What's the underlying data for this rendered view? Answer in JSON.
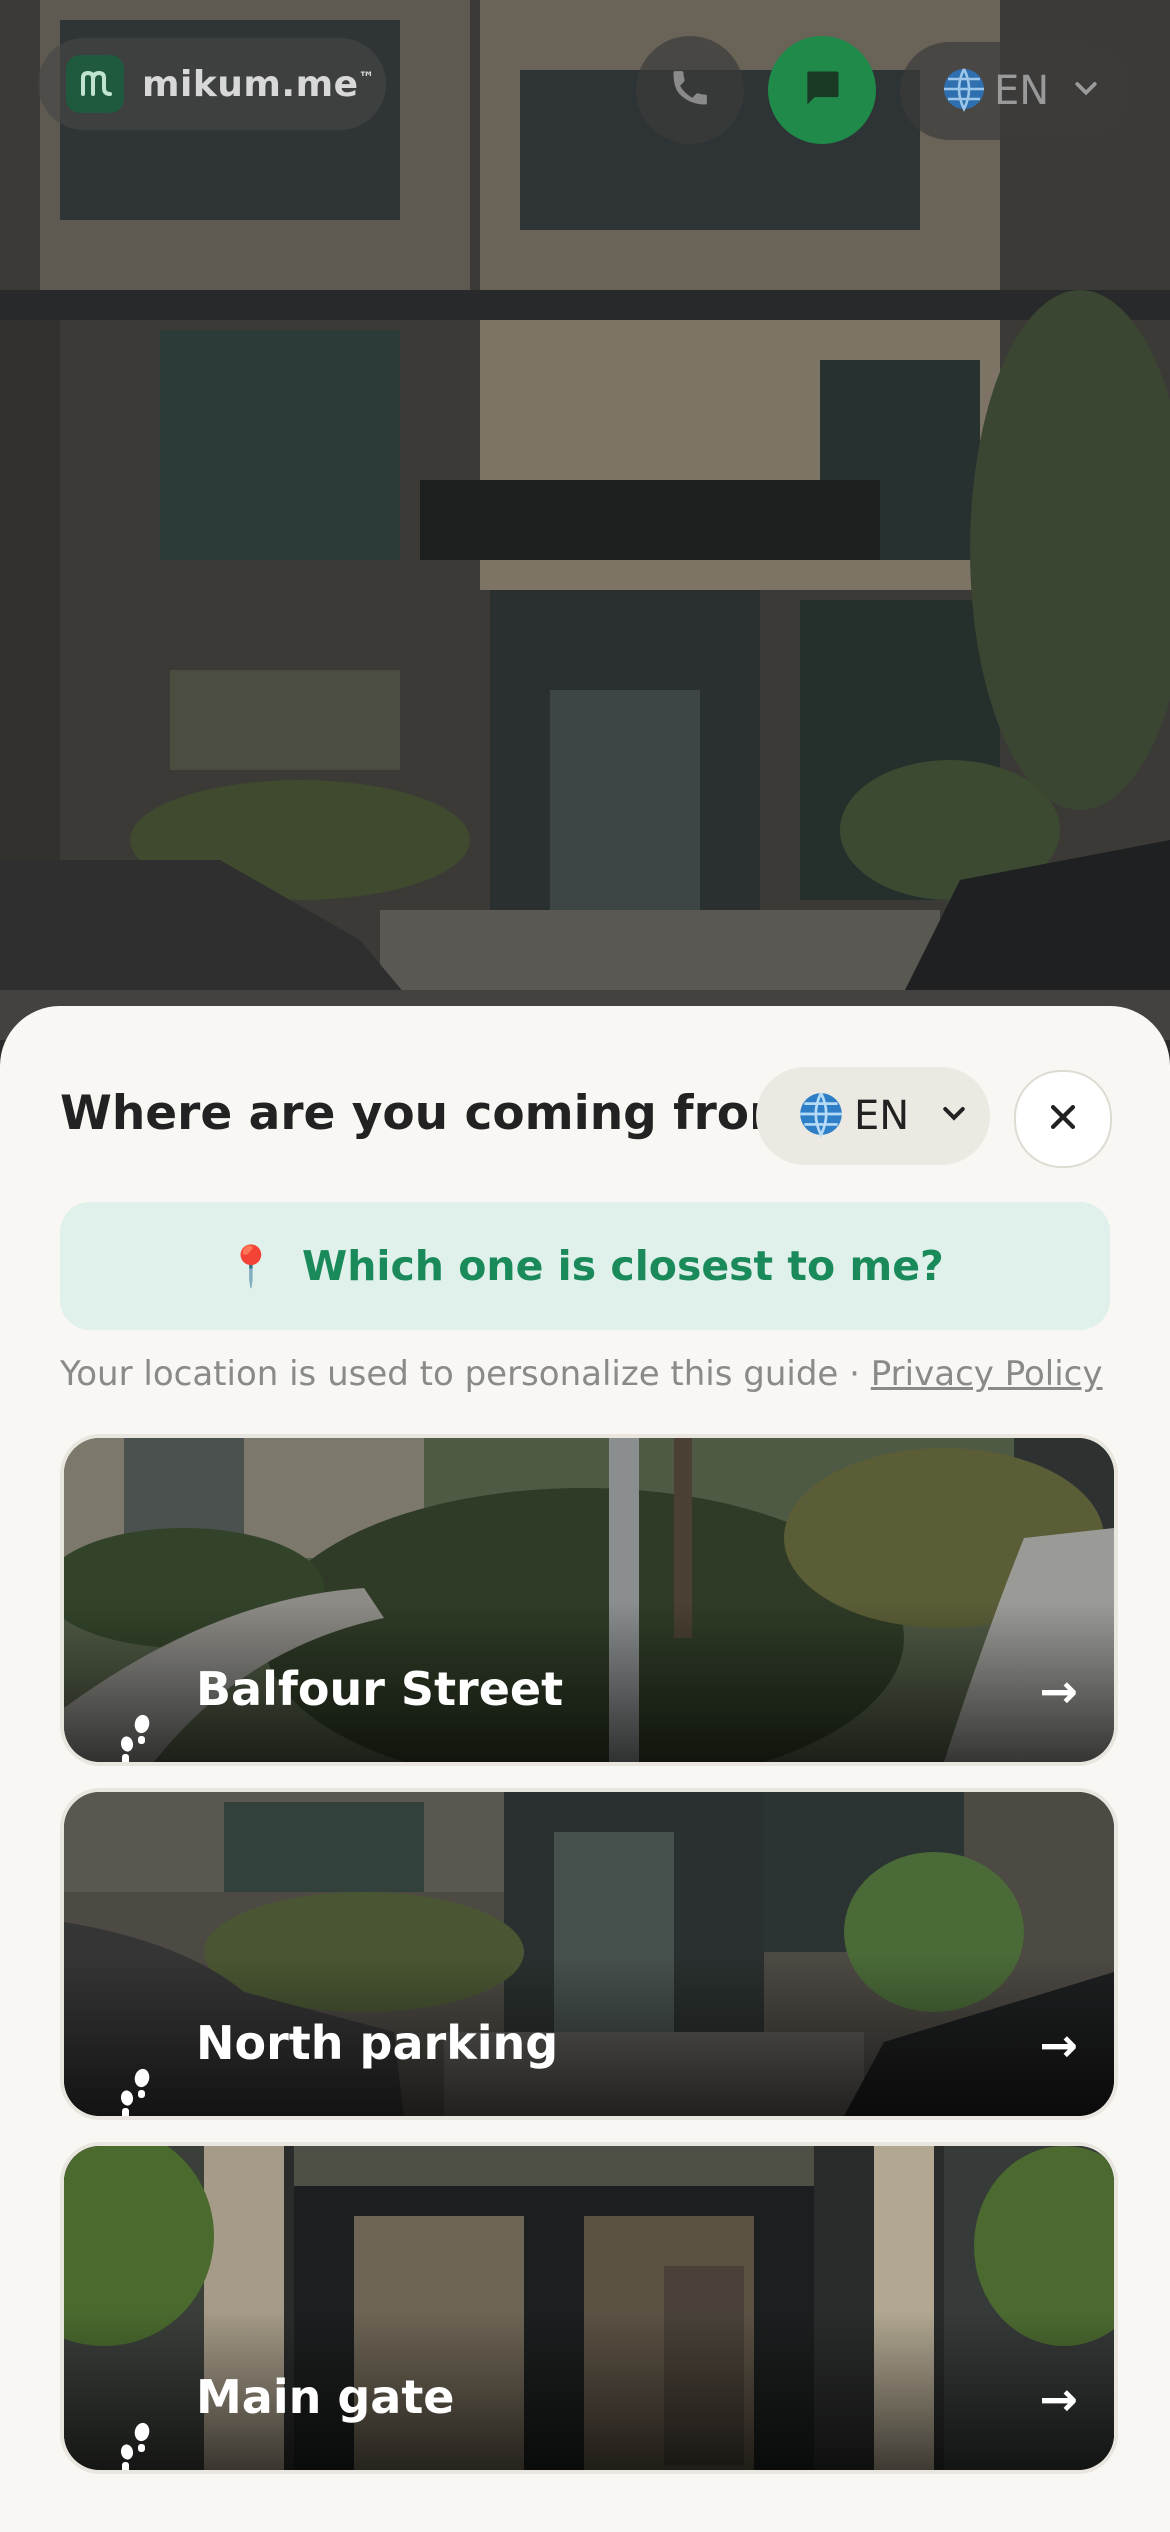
{
  "header": {
    "brand": "mikum.me",
    "brand_tm": "™",
    "lang_code": "EN",
    "globe": "🌐"
  },
  "icons": {
    "phone": "phone-icon",
    "chat": "chat-icon",
    "globe": "globe-icon",
    "chevron": "chevron-down-icon",
    "close": "close-icon",
    "pin": "map-pin-icon",
    "walk": "walking-icon",
    "arrow": "arrow-right-icon"
  },
  "sheet": {
    "title": "Where are you coming from?",
    "lang_code": "EN",
    "globe": "🌐",
    "locate_pin": "📍",
    "locate_label": "Which one is closest to me?",
    "note": "Your location is used to personalize this guide · ",
    "privacy_link": "Privacy Policy"
  },
  "entrances": [
    {
      "label": "Balfour Street",
      "arrow": "→"
    },
    {
      "label": "North parking",
      "arrow": "→"
    },
    {
      "label": "Main gate",
      "arrow": "→"
    }
  ],
  "colors": {
    "accent_green": "#1a8a5a",
    "chat_green": "#1f8a4a",
    "sheet_bg": "#f8f7f3"
  }
}
